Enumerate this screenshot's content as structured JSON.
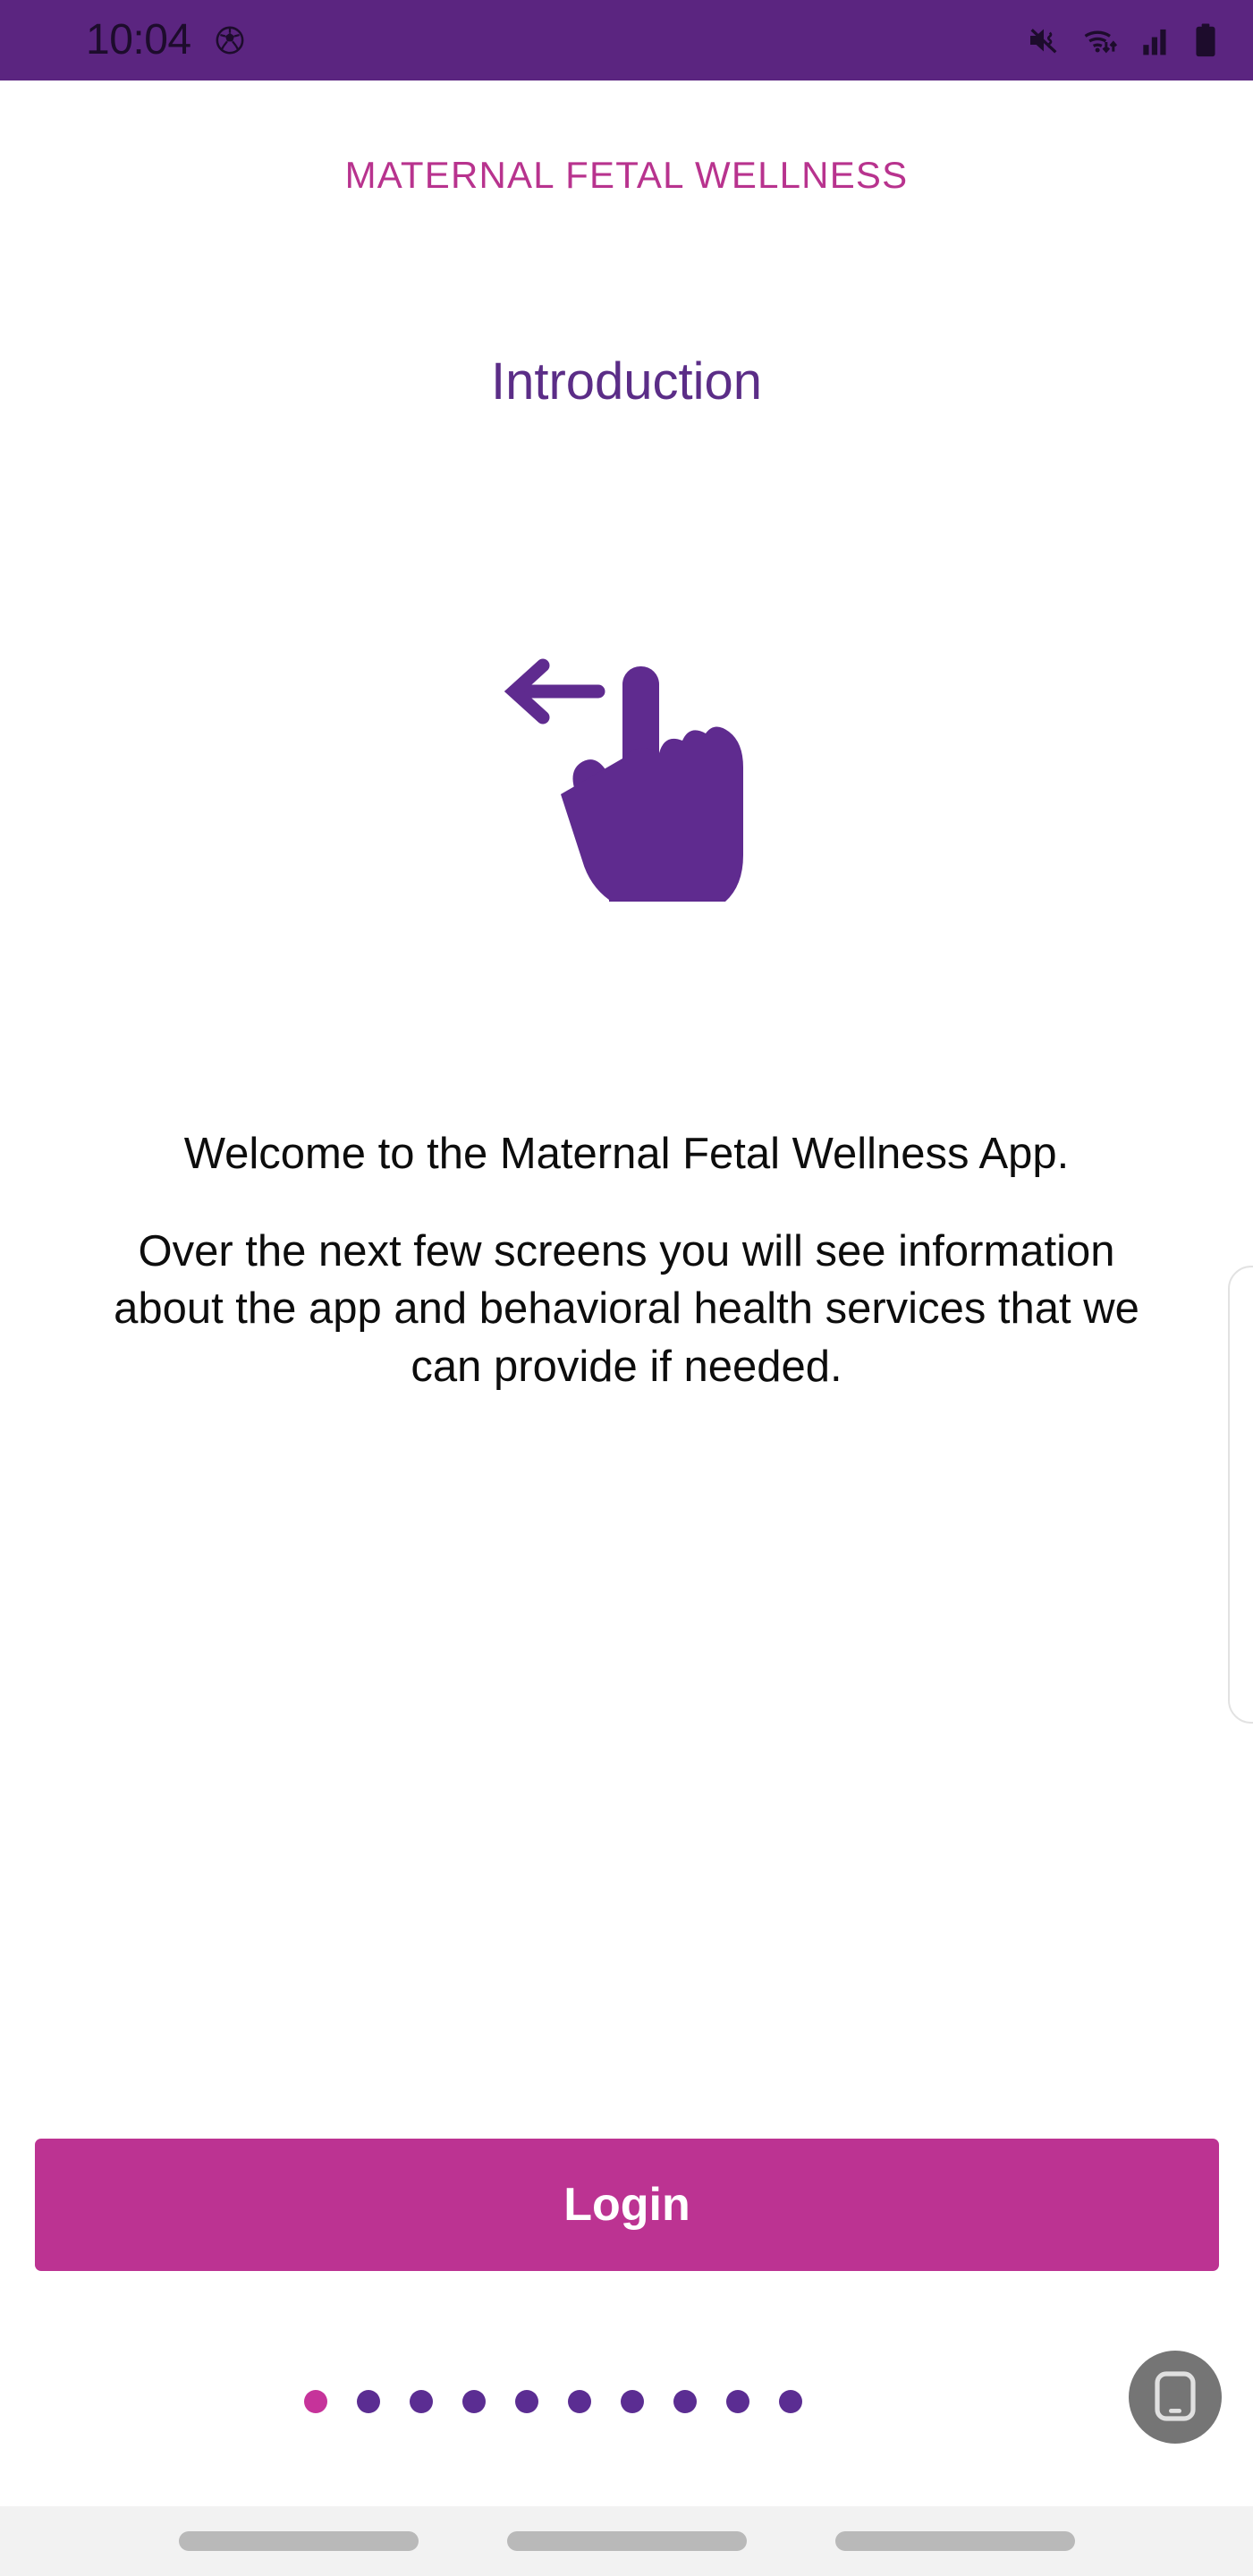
{
  "status_bar": {
    "time": "10:04",
    "background_color": "#5B2580",
    "icon_color": "#1d0c2c",
    "notification_icons": [
      "soccer-ball-icon"
    ],
    "system_icons": [
      "mute-vibrate-icon",
      "wifi-icon",
      "cellular-signal-icon",
      "battery-icon"
    ]
  },
  "app": {
    "title": "MATERNAL FETAL WELLNESS",
    "title_color": "#B8338E"
  },
  "screen": {
    "heading": "Introduction",
    "heading_color": "#5B2D87",
    "gesture_icon": "swipe-left-hand-icon",
    "paragraphs": [
      "Welcome to the Maternal Fetal Wellness App.",
      "Over the next few screens you will see information about the app and behavioral health services that we can provide if needed."
    ]
  },
  "actions": {
    "login_label": "Login",
    "login_color": "#BC3392",
    "login_text_color": "#FFFFFF"
  },
  "pager": {
    "total": 10,
    "active_index": 0,
    "active_color": "#C6339A",
    "inactive_color": "#5B2D92"
  },
  "floating_button": {
    "icon": "mobile-device-icon",
    "background_color": "#757575"
  },
  "navigation_bar": {
    "pills": 3,
    "background_color": "#F2F2F2",
    "pill_color": "#B9B9B9"
  }
}
